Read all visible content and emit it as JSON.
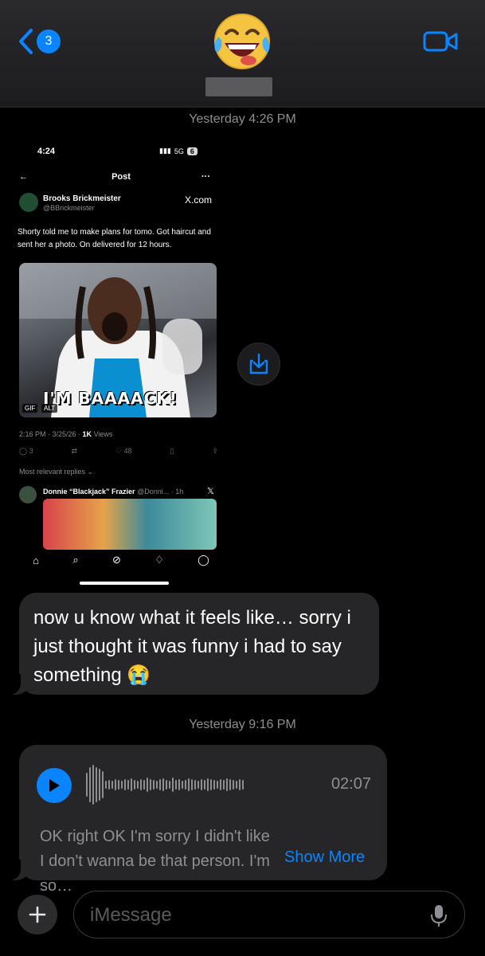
{
  "header": {
    "back_badge": "3",
    "contact_avatar": "face-with-tears-of-joy-emoji",
    "contact_name_redacted": true
  },
  "timestamps": [
    {
      "day": "Yesterday",
      "time": "4:26 PM"
    },
    {
      "day": "Yesterday",
      "time": "9:16 PM"
    }
  ],
  "screenshot": {
    "status_time": "4:24",
    "network": "5G",
    "battery": "6",
    "nav_title": "Post",
    "author_name": "Brooks Brickmeister",
    "author_handle": "@BBrickmeister",
    "source": "X.com",
    "tweet_text": "Shorty told me to make plans for tomo. Got haircut and sent her a photo. On delivered for 12 hours.",
    "gif_caption": "I'M BAAAACK!",
    "gif_tag": "GIF",
    "alt_tag": "ALT",
    "meta_time": "2:16 PM · 3/25/26 · ",
    "meta_views": "1K",
    "meta_views_label": " Views",
    "replies_count": "3",
    "likes_count": "48",
    "replies_header": "Most relevant replies",
    "reply_name": "Donnie “Blackjack” Frazier",
    "reply_handle": "@Donni... · 1h"
  },
  "messages": {
    "incoming_text": "now u know what it feels like… sorry i just thought it was funny i had to say something 😭",
    "voice": {
      "duration": "02:07",
      "transcript": "OK right OK I'm sorry I didn't like I don't wanna be that person. I'm so…",
      "show_more": "Show More"
    }
  },
  "composer": {
    "placeholder": "iMessage"
  },
  "colors": {
    "accent": "#0a84ff",
    "bubble": "#262628",
    "header": "#1c1c1e",
    "secondary_text": "#8e8e93"
  }
}
